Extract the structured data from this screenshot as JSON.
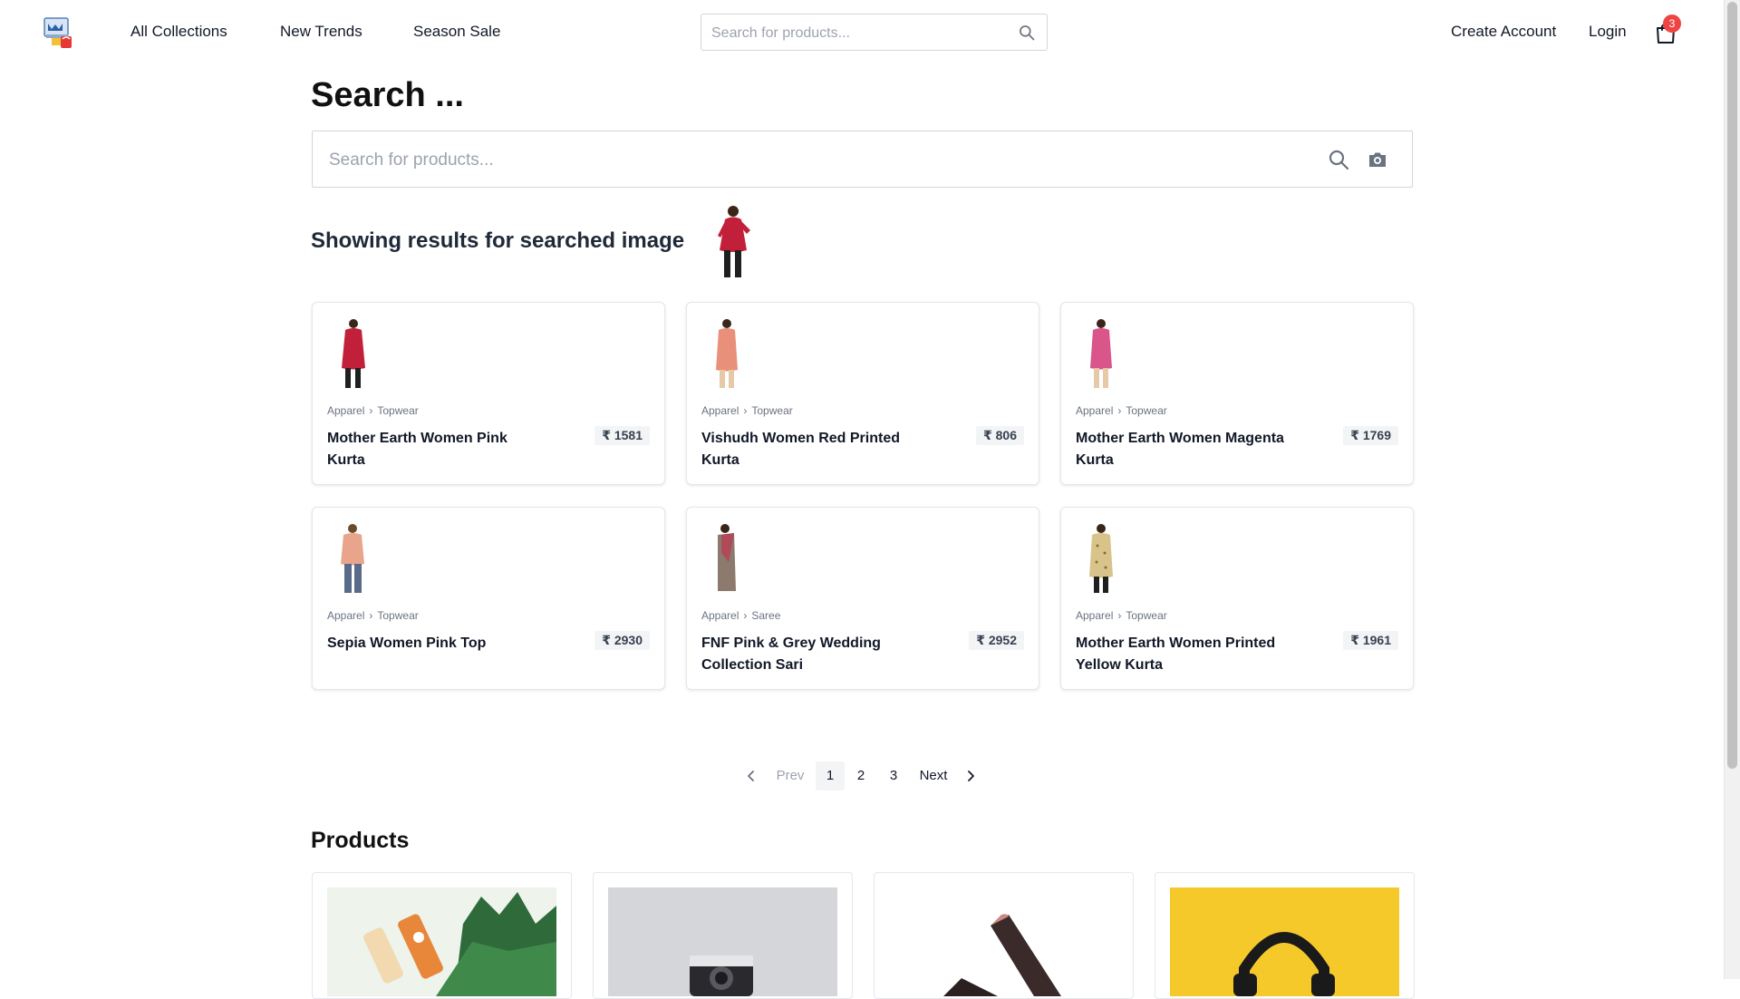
{
  "nav": {
    "links": [
      "All Collections",
      "New Trends",
      "Season Sale"
    ],
    "search_placeholder": "Search for products...",
    "create_account": "Create Account",
    "login": "Login",
    "cart_count": "3"
  },
  "main": {
    "title": "Search ...",
    "search_placeholder": "Search for products...",
    "results_heading": "Showing results for searched image"
  },
  "results": [
    {
      "category": "Apparel",
      "subcategory": "Topwear",
      "name": "Mother Earth Women Pink Kurta",
      "price": "₹ 1581",
      "color": "#c2203a"
    },
    {
      "category": "Apparel",
      "subcategory": "Topwear",
      "name": "Vishudh Women Red Printed Kurta",
      "price": "₹ 806",
      "color": "#e8907a"
    },
    {
      "category": "Apparel",
      "subcategory": "Topwear",
      "name": "Mother Earth Women Magenta Kurta",
      "price": "₹ 1769",
      "color": "#d9558a"
    },
    {
      "category": "Apparel",
      "subcategory": "Topwear",
      "name": "Sepia Women Pink Top",
      "price": "₹ 2930",
      "color": "#e8a58c"
    },
    {
      "category": "Apparel",
      "subcategory": "Saree",
      "name": "FNF Pink & Grey Wedding Collection Sari",
      "price": "₹ 2952",
      "color": "#b04a58"
    },
    {
      "category": "Apparel",
      "subcategory": "Topwear",
      "name": "Mother Earth Women Printed Yellow Kurta",
      "price": "₹ 1961",
      "color": "#d8c48a"
    }
  ],
  "pagination": {
    "prev": "Prev",
    "pages": [
      "1",
      "2",
      "3"
    ],
    "current": "1",
    "next": "Next"
  },
  "products": {
    "title": "Products",
    "images": [
      "plants-bottles",
      "camera",
      "lipstick",
      "headphones-yellow"
    ]
  },
  "colors": {
    "badge": "#ef4444",
    "price_bg": "#f3f4f6",
    "border": "#e5e7eb"
  }
}
